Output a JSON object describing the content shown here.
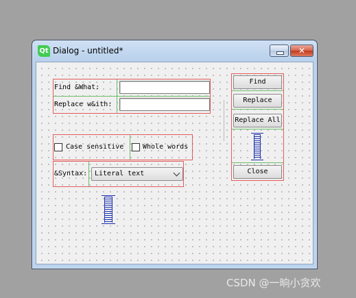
{
  "window": {
    "title": "Dialog - untitled*",
    "logo_text": "Qt",
    "logo_color": "#41cd52",
    "buttons": {
      "minimize_icon": "minimize-icon",
      "close_icon": "close-icon",
      "close_glyph": "✕"
    }
  },
  "form": {
    "find_label": "Find &What:",
    "replace_label": "Replace w&ith:",
    "find_value": "",
    "replace_value": "",
    "case_sensitive": {
      "label": "Case sensitive",
      "checked": false
    },
    "whole_words": {
      "label": "Whole words",
      "checked": false
    },
    "syntax_label": "&Syntax:",
    "syntax_selected": "Literal text"
  },
  "buttons": {
    "find": "Find",
    "replace": "Replace",
    "replace_all": "Replace All",
    "close": "Close"
  },
  "watermark": "CSDN @一晌小贪欢",
  "colors": {
    "layout_frame": "#e35b5b",
    "form_layout_line": "#6bbf6b",
    "spacer": "#1a2fb0"
  }
}
